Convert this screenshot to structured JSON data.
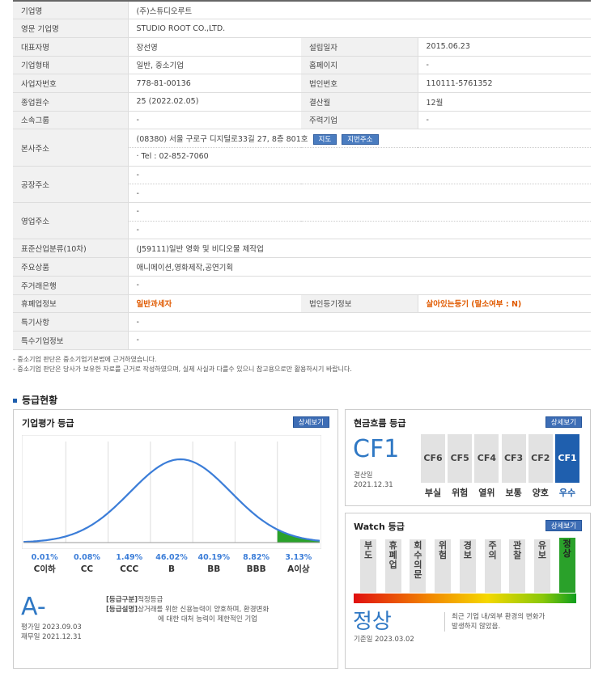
{
  "company": {
    "rows": [
      {
        "label": "기업명",
        "value": "(주)스튜디오루트"
      },
      {
        "label": "영문 기업명",
        "value": "STUDIO ROOT CO.,LTD."
      },
      {
        "label": "대표자명",
        "value": "장선영",
        "label2": "설립일자",
        "value2": "2015.06.23"
      },
      {
        "label": "기업형태",
        "value": "일반, 중소기업",
        "label2": "홈페이지",
        "value2": "-"
      },
      {
        "label": "사업자번호",
        "value": "778-81-00136",
        "label2": "법인번호",
        "value2": "110111-5761352"
      },
      {
        "label": "종업원수",
        "value": "25 (2022.02.05)",
        "label2": "결산월",
        "value2": "12월"
      },
      {
        "label": "소속그룹",
        "value": "-",
        "label2": "주력기업",
        "value2": "-"
      }
    ],
    "hq_label": "본사주소",
    "hq_address": "(08380) 서울 구로구 디지털로33길 27, 8층 801호",
    "map_btn": "지도",
    "lot_btn": "지번주소",
    "hq_tel": "· Tel : 02-852-7060",
    "factory_label": "공장주소",
    "factory_values": [
      "-",
      "-"
    ],
    "office_label": "영업주소",
    "office_values": [
      "-",
      "-"
    ],
    "rows2": [
      {
        "label": "표준산업분류(10차)",
        "value": "(J59111)일반 영화 및 비디오물 제작업"
      },
      {
        "label": "주요상품",
        "value": "애니메이션,영화제작,공연기획"
      },
      {
        "label": "주거래은행",
        "value": "-"
      }
    ],
    "closure_label": "휴폐업정보",
    "closure_value": "일반과세자",
    "registry_label": "법인등기정보",
    "registry_value": "살아있는등기 (말소여부 : N)",
    "rows3": [
      {
        "label": "특기사항",
        "value": "-"
      },
      {
        "label": "특수기업정보",
        "value": "-"
      }
    ]
  },
  "notes": [
    "- 중소기업 판단은 중소기업기본법에 근거하였습니다.",
    "- 중소기업 판단은 당사가 보유한 자료를 근거로 작성하였으며, 실제 사실과 다를수 있으니 참고용으로만 활용하시기 바랍니다."
  ],
  "section_title": "등급현황",
  "credit": {
    "title": "기업평가 등급",
    "detail_btn": "상세보기",
    "grade": "A-",
    "eval_date": "평가일 2023.09.03",
    "fin_date": "재무일 2021.12.31",
    "class_tag": "[등급구분]",
    "class_text": "적정등급",
    "desc_tag": "[등급설명]",
    "desc_line1": "상거래를 위한 신용능력이 양호하며, 환경변화",
    "desc_line2": "에 대한 대처 능력이 제한적인 기업"
  },
  "chart_data": {
    "type": "area",
    "categories": [
      "C이하",
      "CC",
      "CCC",
      "B",
      "BB",
      "BBB",
      "A이상"
    ],
    "values": [
      "0.01%",
      "0.08%",
      "1.49%",
      "46.02%",
      "40.19%",
      "8.82%",
      "3.13%"
    ],
    "highlight_category": "A이상",
    "colors": {
      "curve": "#3b7dd8",
      "highlight": "#2aa12a",
      "label": "#3b7dd8"
    }
  },
  "cashflow": {
    "title": "현금흐름 등급",
    "detail_btn": "상세보기",
    "grade": "CF1",
    "date_label": "결산일",
    "date": "2021.12.31",
    "cells": [
      {
        "code": "CF6",
        "word": "부실"
      },
      {
        "code": "CF5",
        "word": "위험"
      },
      {
        "code": "CF4",
        "word": "열위"
      },
      {
        "code": "CF3",
        "word": "보통"
      },
      {
        "code": "CF2",
        "word": "양호"
      },
      {
        "code": "CF1",
        "word": "우수",
        "active": true
      }
    ]
  },
  "watch": {
    "title": "Watch 등급",
    "detail_btn": "상세보기",
    "levels": [
      "부도",
      "휴폐업",
      "회수의문",
      "위험",
      "경보",
      "주의",
      "관찰",
      "유보",
      "정상"
    ],
    "active_index": 8,
    "grade": "정상",
    "date": "기준일 2023.03.02",
    "desc_line1": "최근 기업 내/외부 환경의 변화가",
    "desc_line2": "발생하지 않았음."
  }
}
